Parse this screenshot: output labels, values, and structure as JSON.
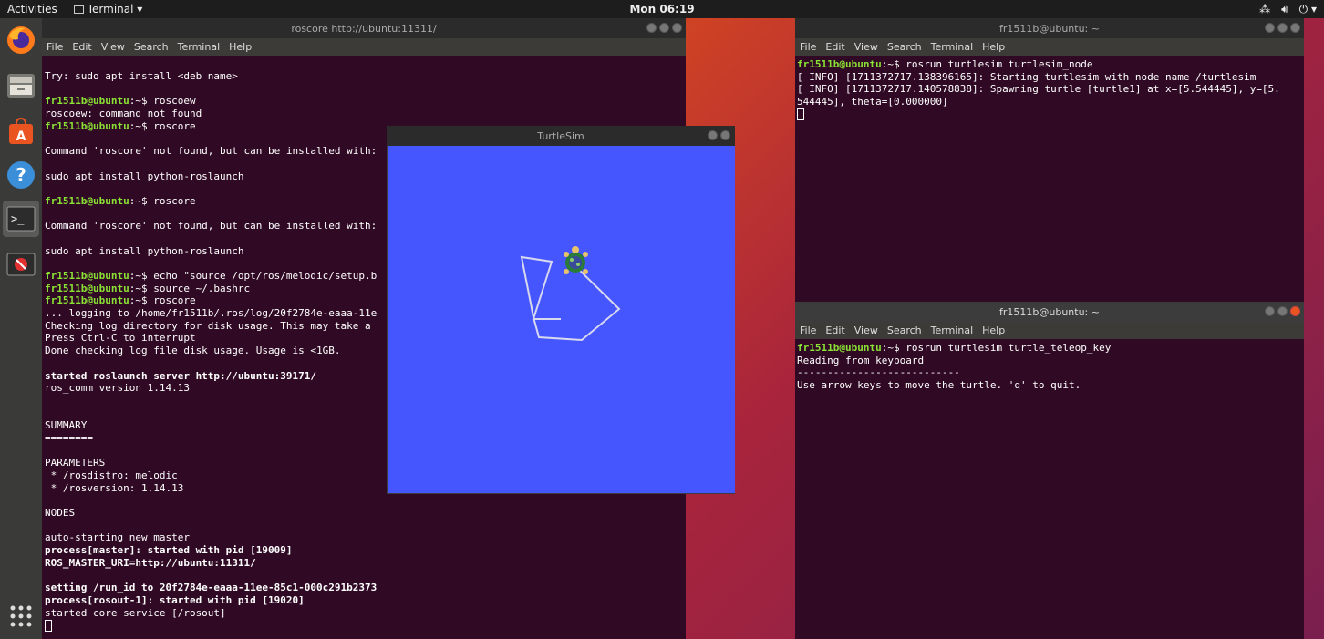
{
  "topbar": {
    "activities": "Activities",
    "app_menu": "Terminal ▾",
    "clock": "Mon 06:19"
  },
  "dock": {
    "items": [
      "firefox-icon",
      "files-icon",
      "software-center-icon",
      "help-icon",
      "terminal-icon",
      "trash-blocked-icon",
      "app-grid-icon"
    ]
  },
  "roscore_window": {
    "title": "roscore http://ubuntu:11311/",
    "menu": [
      "File",
      "Edit",
      "View",
      "Search",
      "Terminal",
      "Help"
    ],
    "lines": [
      {
        "t": "Try: sudo apt install <deb name>"
      },
      {
        "t": ""
      },
      {
        "p": "fr1511b@ubuntu",
        "t": ":~$ roscoew"
      },
      {
        "t": "roscoew: command not found"
      },
      {
        "p": "fr1511b@ubuntu",
        "t": ":~$ roscore"
      },
      {
        "t": ""
      },
      {
        "t": "Command 'roscore' not found, but can be installed with:"
      },
      {
        "t": ""
      },
      {
        "t": "sudo apt install python-roslaunch"
      },
      {
        "t": ""
      },
      {
        "p": "fr1511b@ubuntu",
        "t": ":~$ roscore"
      },
      {
        "t": ""
      },
      {
        "t": "Command 'roscore' not found, but can be installed with:"
      },
      {
        "t": ""
      },
      {
        "t": "sudo apt install python-roslaunch"
      },
      {
        "t": ""
      },
      {
        "p": "fr1511b@ubuntu",
        "t": ":~$ echo \"source /opt/ros/melodic/setup.b"
      },
      {
        "p": "fr1511b@ubuntu",
        "t": ":~$ source ~/.bashrc"
      },
      {
        "p": "fr1511b@ubuntu",
        "t": ":~$ roscore"
      },
      {
        "t": "... logging to /home/fr1511b/.ros/log/20f2784e-eaaa-11e"
      },
      {
        "t": "Checking log directory for disk usage. This may take a"
      },
      {
        "t": "Press Ctrl-C to interrupt"
      },
      {
        "t": "Done checking log file disk usage. Usage is <1GB."
      },
      {
        "t": ""
      },
      {
        "b": "started roslaunch server http://ubuntu:39171/"
      },
      {
        "t": "ros_comm version 1.14.13"
      },
      {
        "t": ""
      },
      {
        "t": ""
      },
      {
        "t": "SUMMARY"
      },
      {
        "t": "========"
      },
      {
        "t": ""
      },
      {
        "t": "PARAMETERS"
      },
      {
        "t": " * /rosdistro: melodic"
      },
      {
        "t": " * /rosversion: 1.14.13"
      },
      {
        "t": ""
      },
      {
        "t": "NODES"
      },
      {
        "t": ""
      },
      {
        "t": "auto-starting new master"
      },
      {
        "b": "process[master]: started with pid [19009]"
      },
      {
        "b": "ROS_MASTER_URI=http://ubuntu:11311/"
      },
      {
        "t": ""
      },
      {
        "b": "setting /run_id to 20f2784e-eaaa-11ee-85c1-000c291b2373"
      },
      {
        "b": "process[rosout-1]: started with pid [19020]"
      },
      {
        "t": "started core service [/rosout]"
      }
    ]
  },
  "turtlesim_window": {
    "title": "TurtleSim",
    "bg_color": "#4556ff"
  },
  "node_window": {
    "title": "fr1511b@ubuntu: ~",
    "menu": [
      "File",
      "Edit",
      "View",
      "Search",
      "Terminal",
      "Help"
    ],
    "lines": [
      {
        "p": "fr1511b@ubuntu",
        "t": ":~$ rosrun turtlesim turtlesim_node"
      },
      {
        "t": "[ INFO] [1711372717.138396165]: Starting turtlesim with node name /turtlesim"
      },
      {
        "t": "[ INFO] [1711372717.140578838]: Spawning turtle [turtle1] at x=[5.544445], y=[5."
      },
      {
        "t": "544445], theta=[0.000000]"
      }
    ]
  },
  "teleop_window": {
    "title": "fr1511b@ubuntu: ~",
    "menu": [
      "File",
      "Edit",
      "View",
      "Search",
      "Terminal",
      "Help"
    ],
    "lines": [
      {
        "p": "fr1511b@ubuntu",
        "t": ":~$ rosrun turtlesim turtle_teleop_key"
      },
      {
        "t": "Reading from keyboard"
      },
      {
        "t": "---------------------------"
      },
      {
        "t": "Use arrow keys to move the turtle. 'q' to quit."
      }
    ]
  }
}
